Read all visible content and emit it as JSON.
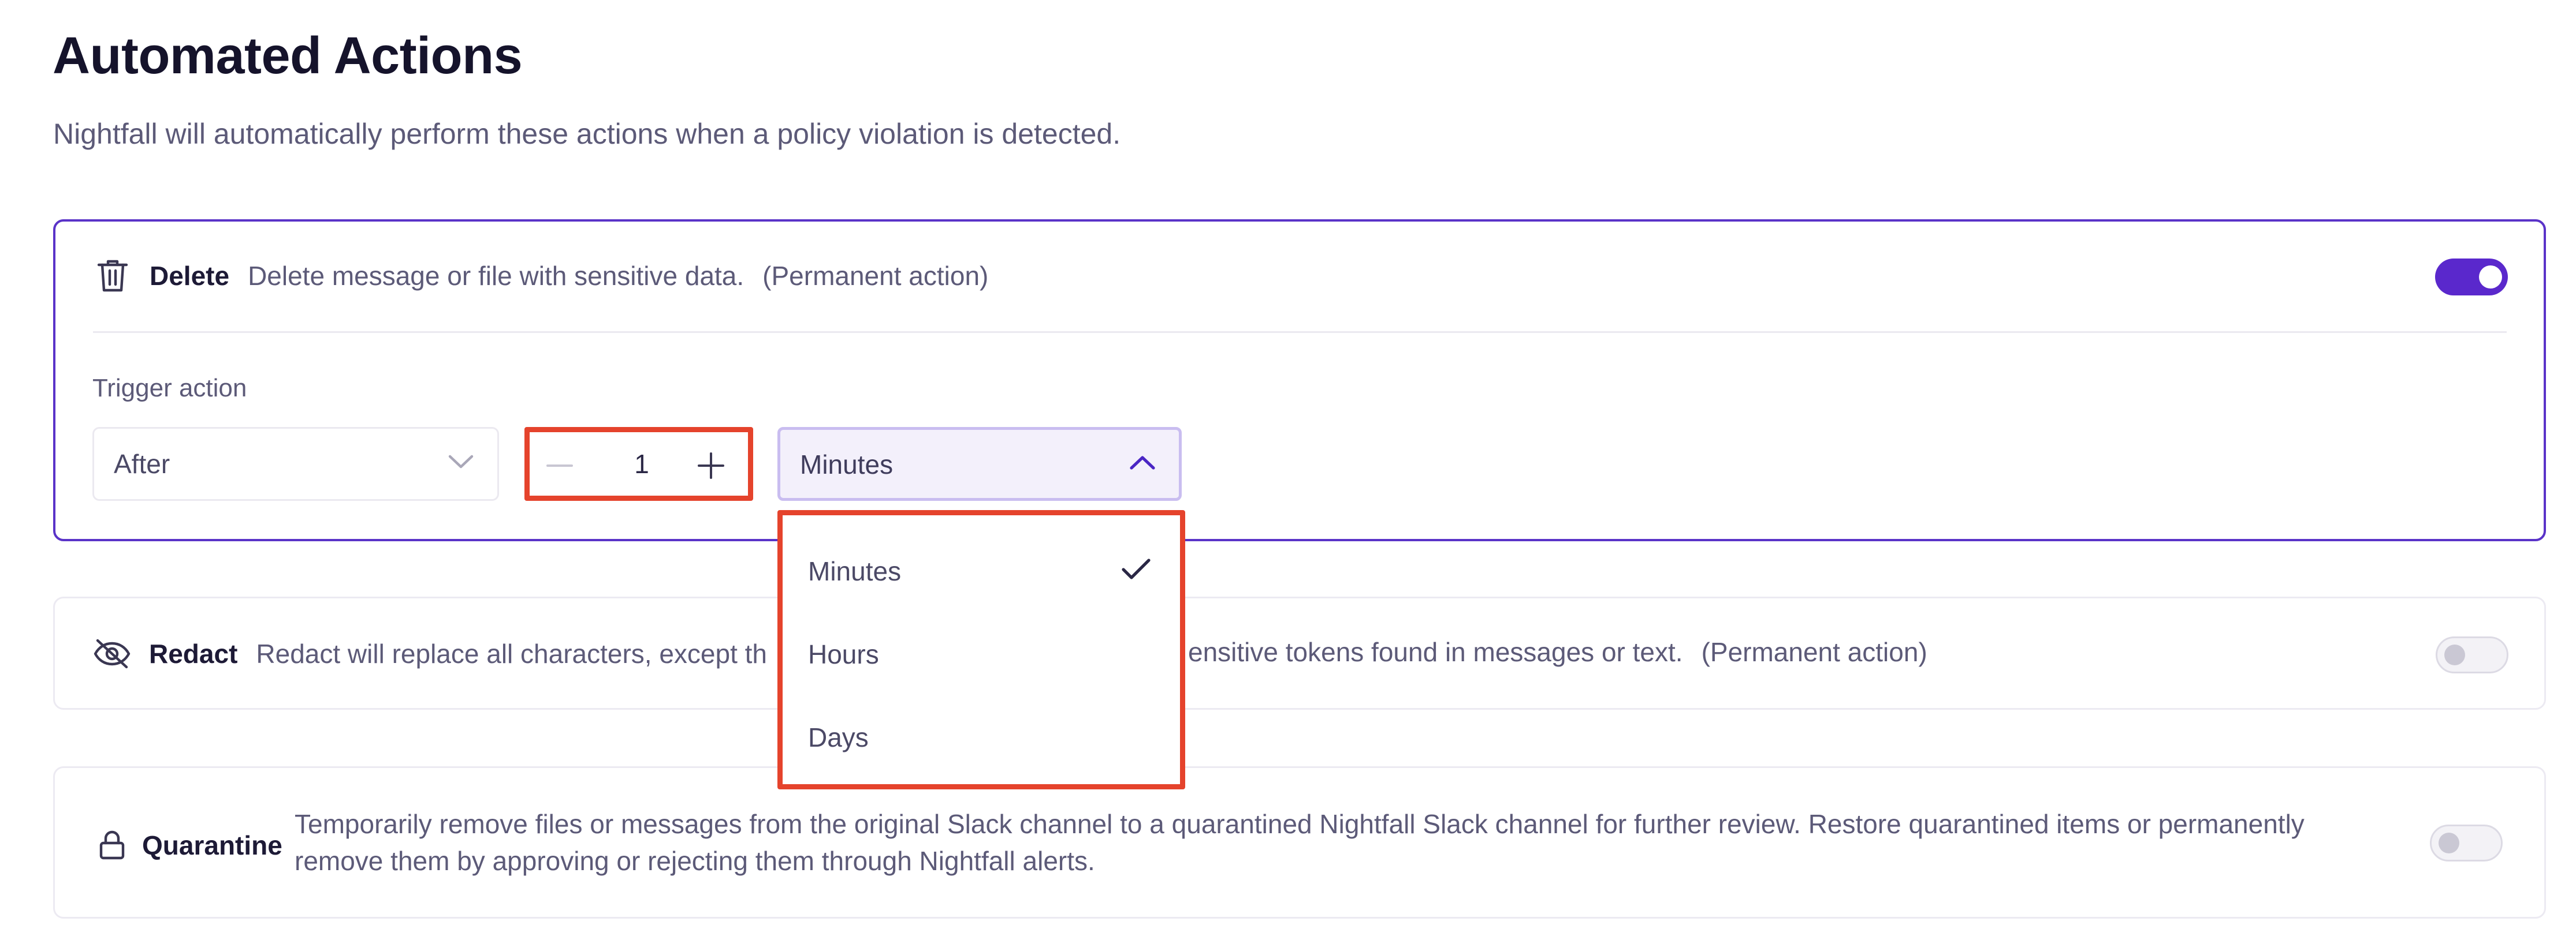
{
  "page": {
    "title": "Automated Actions",
    "subtitle": "Nightfall will automatically perform these actions when a policy violation is detected."
  },
  "delete": {
    "name": "Delete",
    "description": "Delete message or file with sensitive data.",
    "permanent": "(Permanent action)",
    "enabled": true,
    "trigger_label": "Trigger action",
    "timing_select": "After",
    "quantity": "1",
    "unit_select": "Minutes",
    "unit_options": [
      "Minutes",
      "Hours",
      "Days"
    ],
    "selected_unit": "Minutes"
  },
  "redact": {
    "name": "Redact",
    "description_before": "Redact will replace all characters, except th",
    "description_after": "ensitive tokens found in messages or text.",
    "permanent": "(Permanent action)",
    "enabled": false
  },
  "quarantine": {
    "name": "Quarantine",
    "description": "Temporarily remove files or messages from the original Slack channel to a quarantined Nightfall Slack channel for further review. Restore quarantined items or permanently remove them by approving or rejecting them through Nightfall alerts.",
    "enabled": false
  },
  "colors": {
    "accent": "#5a28cc",
    "highlight": "#e5432c"
  },
  "icons": {
    "delete": "trash-icon",
    "redact": "eye-slash-icon",
    "quarantine": "lock-icon",
    "chevron_down": "chevron-down-icon",
    "chevron_up": "chevron-up-icon",
    "check": "check-icon",
    "minus": "minus-icon",
    "plus": "plus-icon"
  }
}
